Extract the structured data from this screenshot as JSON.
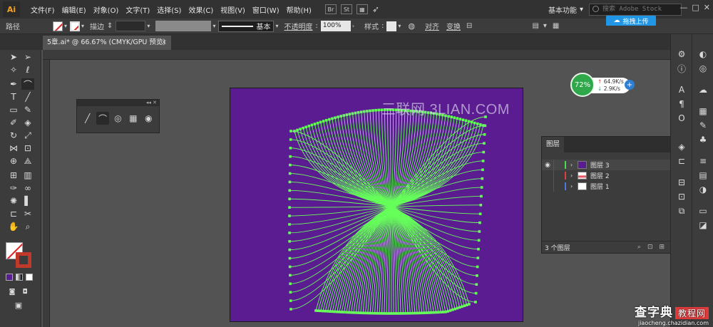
{
  "menubar": {
    "app_logo": "Ai",
    "items": [
      "文件(F)",
      "编辑(E)",
      "对象(O)",
      "文字(T)",
      "选择(S)",
      "效果(C)",
      "视图(V)",
      "窗口(W)",
      "帮助(H)"
    ],
    "bridge_label": "Br",
    "stock_label": "St",
    "workspace": "基本功能",
    "stock_search_placeholder": "搜索 Adobe Stock",
    "upload_label": "拖拽上传"
  },
  "controlbar": {
    "selection_label": "路径",
    "stroke_label": "描边",
    "stroke_style": "基本",
    "opacity_label": "不透明度",
    "opacity_value": "100%",
    "style_label": "样式",
    "align_label": "对齐",
    "transform_label": "变换"
  },
  "document": {
    "tab_title": "5章.ai* @ 66.67% (CMYK/GPU 预览)",
    "close_glyph": "×"
  },
  "canvas": {
    "watermark_text": "三联网 3LIAN.COM",
    "artboard_color": "#5c1c91",
    "path_color": "#66ff5a"
  },
  "speed_widget": {
    "percent": "72%",
    "upload_speed": "64.9K/s",
    "download_speed": "2.9K/s"
  },
  "layers_panel": {
    "tab_title": "图层",
    "layers": [
      {
        "name": "图层 3",
        "color": "#4cd94c",
        "selected": true,
        "visible": true
      },
      {
        "name": "图层 2",
        "color": "#e04040",
        "selected": false,
        "visible": false
      },
      {
        "name": "图层 1",
        "color": "#4a7bdc",
        "selected": false,
        "visible": false
      }
    ],
    "footer_count": "3 个图层"
  },
  "site_watermark": {
    "name": "查字典",
    "tag": "教程网",
    "url": "jiaocheng.chazidian.com"
  }
}
